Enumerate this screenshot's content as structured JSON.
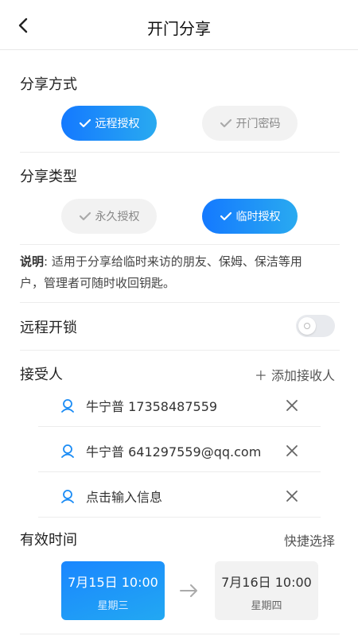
{
  "header": {
    "title": "开门分享",
    "back_icon": "chevron-left-icon"
  },
  "share_method": {
    "title": "分享方式",
    "options": [
      {
        "label": "远程授权",
        "selected": true
      },
      {
        "label": "开门密码",
        "selected": false
      }
    ]
  },
  "share_type": {
    "title": "分享类型",
    "options": [
      {
        "label": "永久授权",
        "selected": false
      },
      {
        "label": "临时授权",
        "selected": true
      }
    ]
  },
  "note": {
    "prefix": "说明",
    "text": ": 适用于分享给临时来访的朋友、保姆、保洁等用户，管理者可随时收回钥匙。"
  },
  "remote_unlock": {
    "label": "远程开锁",
    "enabled": false
  },
  "recipients": {
    "title": "接受人",
    "add_label": "＋ 添加接收人",
    "items": [
      {
        "text": "牛宁普 17358487559"
      },
      {
        "text": "牛宁普 641297559@qq.com"
      },
      {
        "text": "点击输入信息"
      }
    ]
  },
  "validity": {
    "title": "有效时间",
    "quick_select": "快捷选择",
    "start": {
      "date": "7月15日 10:00",
      "weekday": "星期三"
    },
    "end": {
      "date": "7月16日 10:00",
      "weekday": "星期四"
    }
  },
  "colors": {
    "accent": "#1479ff",
    "accent_light": "#29aaf0"
  }
}
